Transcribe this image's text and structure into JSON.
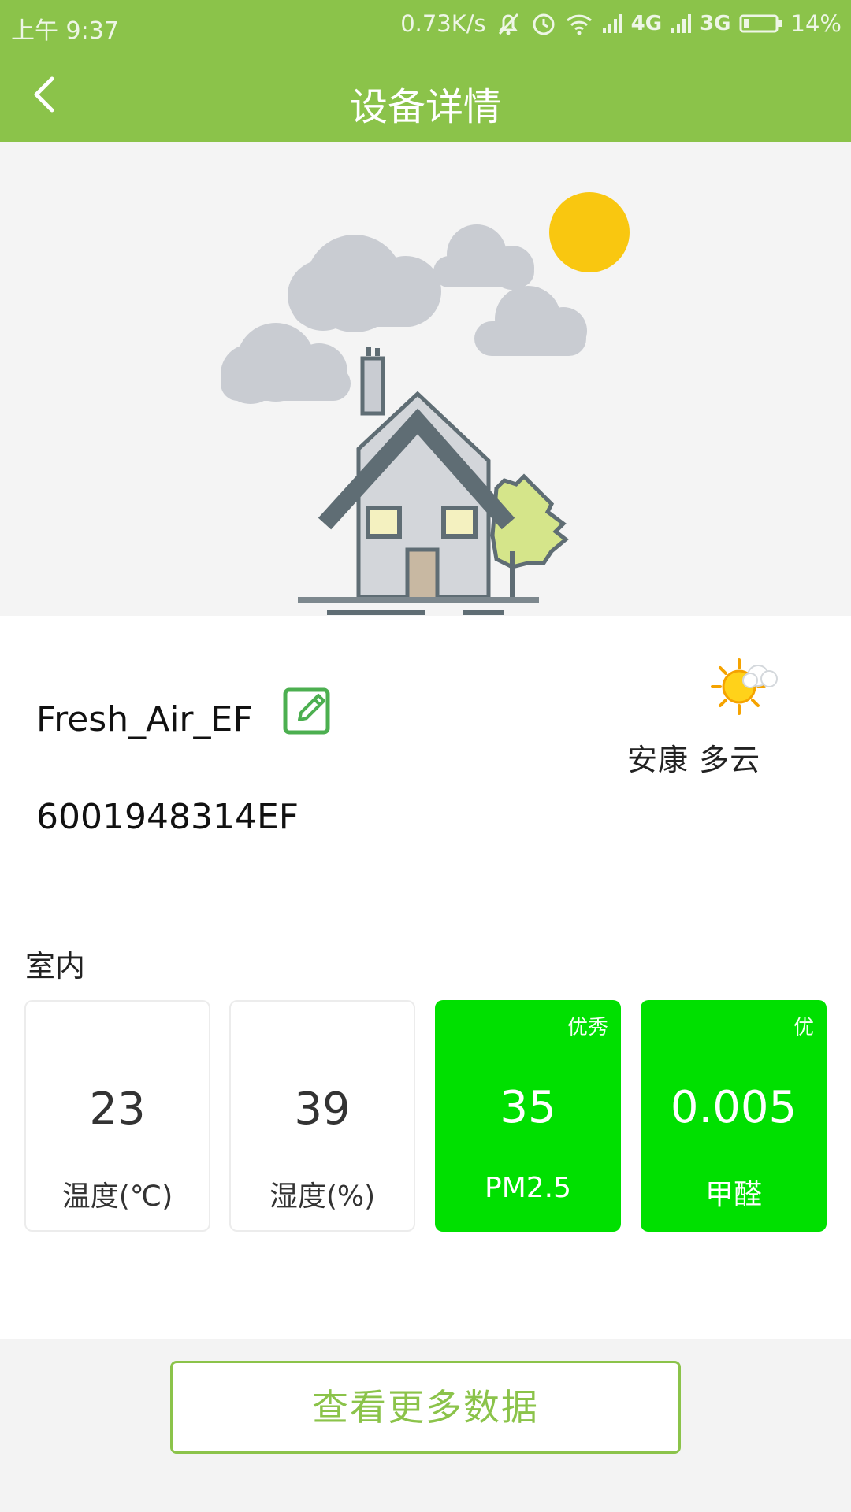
{
  "status_bar": {
    "time": "上午 9:37",
    "net_speed": "0.73K/s",
    "network_1": "4G",
    "network_2": "3G",
    "battery": "14%"
  },
  "header": {
    "title": "设备详情",
    "back_icon": "chevron-left-icon"
  },
  "hero": {
    "illustration": "house-with-clouds-and-sun",
    "colors": {
      "sun": "#f9c710",
      "cloud": "#c9ccd2",
      "roof": "#5f6d74",
      "tree": "#d5e58a"
    }
  },
  "device": {
    "name": "Fresh_Air_EF",
    "id": "6001948314EF",
    "edit_icon": "edit-icon"
  },
  "weather": {
    "icon": "partly-sunny-icon",
    "text": "安康 多云"
  },
  "indoor": {
    "label": "室内",
    "cards": [
      {
        "value": "23",
        "label": "温度(℃)",
        "level": ""
      },
      {
        "value": "39",
        "label": "湿度(%)",
        "level": ""
      },
      {
        "value": "35",
        "label": "PM2.5",
        "level": "优秀"
      },
      {
        "value": "0.005",
        "label": "甲醛",
        "level": "优"
      }
    ]
  },
  "more_button": {
    "label": "查看更多数据"
  },
  "colors": {
    "header": "#8bc34a",
    "good_card": "#00e000",
    "accent": "#8bc34a"
  }
}
